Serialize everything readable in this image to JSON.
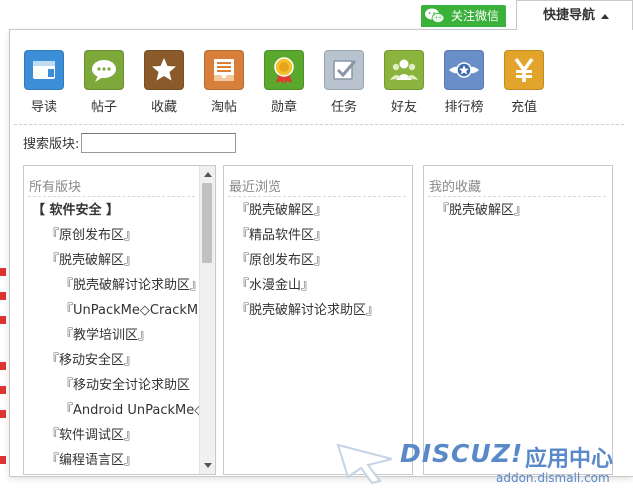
{
  "header": {
    "wechat_label": "关注微信",
    "quick_nav_label": "快捷导航"
  },
  "nav_items": [
    {
      "label": "导读",
      "icon": "guide-icon",
      "color": "#3d8ed8"
    },
    {
      "label": "帖子",
      "icon": "chat-bubble-icon",
      "color": "#7da83a"
    },
    {
      "label": "收藏",
      "icon": "star-icon",
      "color": "#8b5a2b"
    },
    {
      "label": "淘帖",
      "icon": "inbox-icon",
      "color": "#d77f3b"
    },
    {
      "label": "勋章",
      "icon": "medal-icon",
      "color": "#5aa82e"
    },
    {
      "label": "任务",
      "icon": "task-icon",
      "color": "#b9c3cf"
    },
    {
      "label": "好友",
      "icon": "friends-icon",
      "color": "#8ab43d"
    },
    {
      "label": "排行榜",
      "icon": "ranking-icon",
      "color": "#6a8fc8"
    },
    {
      "label": "充值",
      "icon": "yen-icon",
      "color": "#e2a42a"
    }
  ],
  "search": {
    "label": "搜索版块:",
    "value": ""
  },
  "all_boards": {
    "title": "所有版块",
    "items": [
      {
        "label": "【 软件安全 】",
        "level": 0
      },
      {
        "label": "『原创发布区』",
        "level": 1
      },
      {
        "label": "『脱壳破解区』",
        "level": 1
      },
      {
        "label": "『脱壳破解讨论求助区』",
        "level": 2
      },
      {
        "label": "『UnPackMe◇CrackMe",
        "level": 2
      },
      {
        "label": "『教学培训区』",
        "level": 2
      },
      {
        "label": "『移动安全区』",
        "level": 1
      },
      {
        "label": "『移动安全讨论求助区",
        "level": 2
      },
      {
        "label": "『Android UnPackMe◇",
        "level": 2
      },
      {
        "label": "『软件调试区』",
        "level": 1
      },
      {
        "label": "『编程语言区』",
        "level": 1
      }
    ]
  },
  "recent": {
    "title": "最近浏览",
    "items": [
      "『脱壳破解区』",
      "『精品软件区』",
      "『原创发布区』",
      "『水漫金山』",
      "『脱壳破解讨论求助区』"
    ]
  },
  "favorites": {
    "title": "我的收藏",
    "items": [
      "『脱壳破解区』"
    ]
  },
  "watermark": {
    "brand": "DISCUZ!",
    "cn": "应用中心",
    "url": "addon.dismall.com"
  }
}
